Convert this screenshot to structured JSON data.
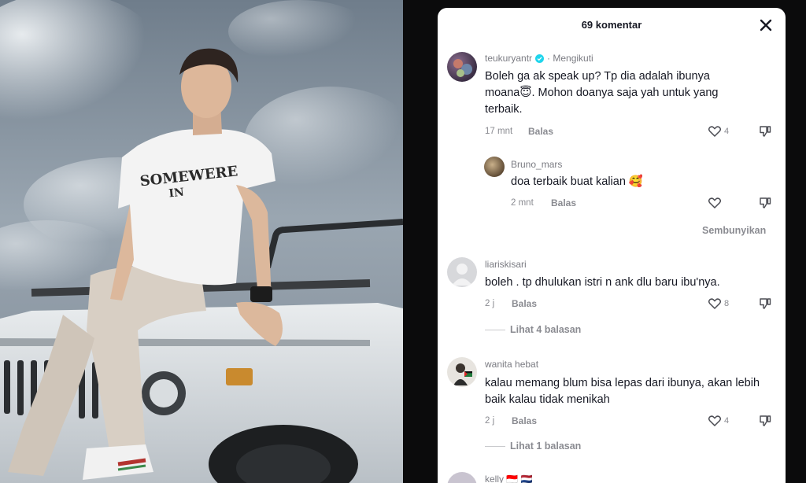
{
  "panel": {
    "title": "69 komentar",
    "close_icon": "close-icon"
  },
  "comments": [
    {
      "username": "teukuryantr",
      "verified": true,
      "follow_tag": "· Mengikuti",
      "text": "Boleh ga ak speak up? Tp dia adalah ibunya moana😇. Mohon doanya saja yah untuk yang terbaik.",
      "time": "17 mnt",
      "reply_label": "Balas",
      "likes": "4"
    },
    {
      "username": "Bruno_mars",
      "text": "doa terbaik buat kalian 🥰",
      "time": "2 mnt",
      "reply_label": "Balas",
      "likes": ""
    },
    {
      "username": "liariskisari",
      "text": "boleh . tp dhulukan istri n ank dlu baru ibu'nya.",
      "time": "2 j",
      "reply_label": "Balas",
      "likes": "8",
      "view_replies": "Lihat 4 balasan"
    },
    {
      "username": "wanita hebat",
      "text": "kalau memang blum bisa lepas dari ibunya, akan lebih baik kalau tidak menikah",
      "time": "2 j",
      "reply_label": "Balas",
      "likes": "4",
      "view_replies": "Lihat 1 balasan"
    },
    {
      "username": "kelly 🇮🇩 🇳🇱"
    }
  ],
  "hide_label": "Sembunyikan",
  "colors": {
    "text_primary": "#161823",
    "text_secondary": "#8a8b91",
    "verified": "#20d5ec",
    "panel_bg": "#ffffff",
    "backdrop": "#0b0b0c"
  }
}
